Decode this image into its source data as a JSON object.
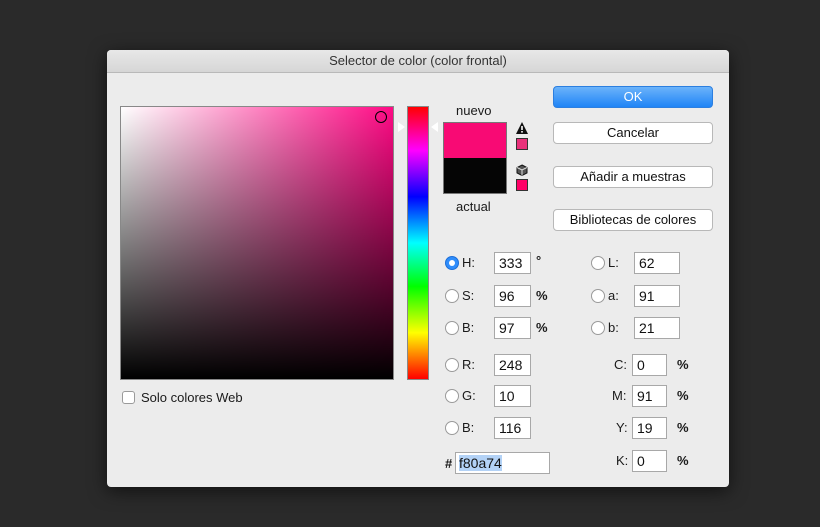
{
  "dialog": {
    "title": "Selector de color (color frontal)",
    "new_label": "nuevo",
    "current_label": "actual",
    "new_color": "#f80a74",
    "current_color": "#050505",
    "hue_color": "#ff0080"
  },
  "buttons": {
    "ok": "OK",
    "cancel": "Cancelar",
    "add_to_swatches": "Añadir a muestras",
    "color_libraries": "Bibliotecas de colores"
  },
  "web_only": {
    "label": "Solo colores Web",
    "checked": false
  },
  "hsb": {
    "h": {
      "label": "H:",
      "value": "333",
      "unit": "°",
      "selected": true
    },
    "s": {
      "label": "S:",
      "value": "96",
      "unit": "%"
    },
    "b": {
      "label": "B:",
      "value": "97",
      "unit": "%"
    }
  },
  "rgb": {
    "r": {
      "label": "R:",
      "value": "248"
    },
    "g": {
      "label": "G:",
      "value": "10"
    },
    "b": {
      "label": "B:",
      "value": "116"
    }
  },
  "lab": {
    "l": {
      "label": "L:",
      "value": "62"
    },
    "a": {
      "label": "a:",
      "value": "91"
    },
    "b": {
      "label": "b:",
      "value": "21"
    }
  },
  "cmyk": {
    "c": {
      "label": "C:",
      "value": "0",
      "unit": "%"
    },
    "m": {
      "label": "M:",
      "value": "91",
      "unit": "%"
    },
    "y": {
      "label": "Y:",
      "value": "19",
      "unit": "%"
    },
    "k": {
      "label": "K:",
      "value": "0",
      "unit": "%"
    }
  },
  "hex": {
    "label": "#",
    "value": "f80a74"
  }
}
